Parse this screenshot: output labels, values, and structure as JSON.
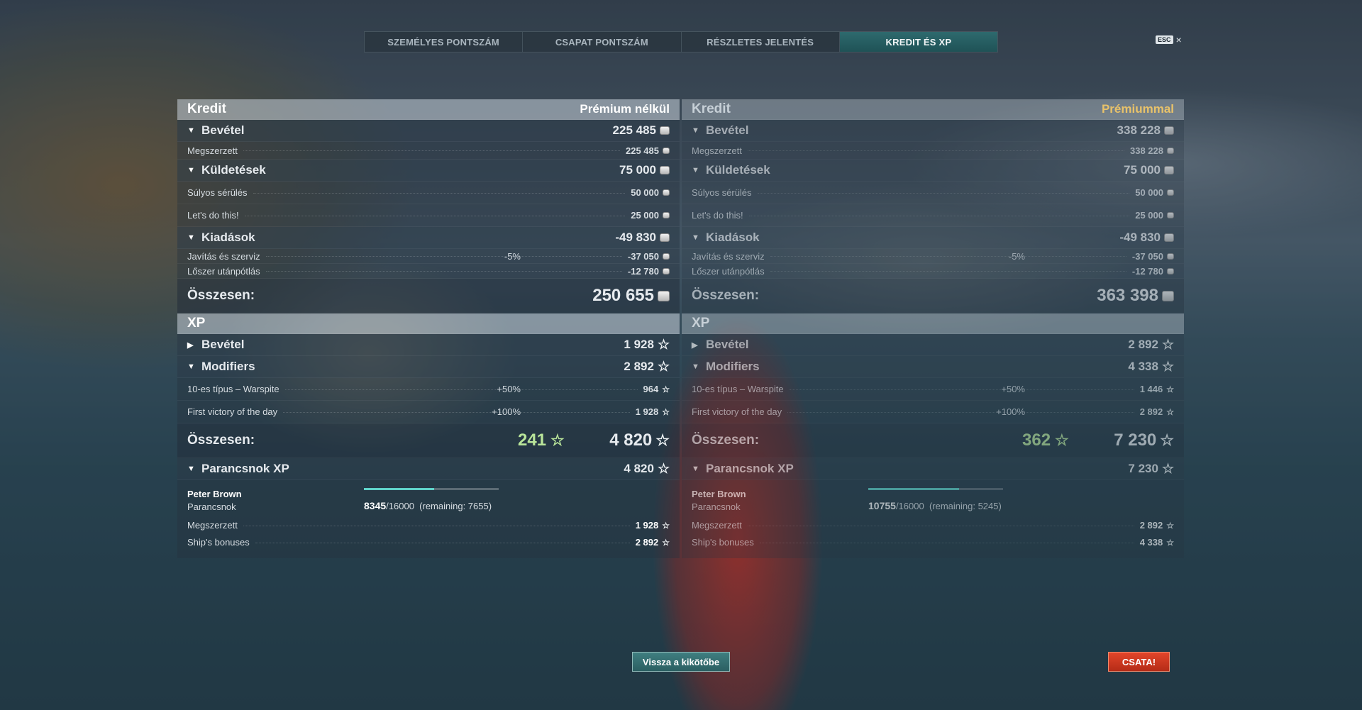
{
  "tabs": [
    "SZEMÉLYES PONTSZÁM",
    "CSAPAT PONTSZÁM",
    "RÉSZLETES JELENTÉS",
    "KREDIT ÉS XP"
  ],
  "active_tab": "KREDIT ÉS XP",
  "esc": {
    "key": "ESC",
    "close": "×"
  },
  "left": {
    "credit_title": "Kredit",
    "column_title": "Prémium nélkül",
    "income": {
      "label": "Bevétel",
      "value": "225 485"
    },
    "earned": {
      "label": "Megszerzett",
      "value": "225 485"
    },
    "missions": {
      "label": "Küldetések",
      "value": "75 000"
    },
    "mission1": {
      "label": "Súlyos sérülés",
      "value": "50 000"
    },
    "mission2": {
      "label": "Let's do this!",
      "value": "25 000"
    },
    "expenses": {
      "label": "Kiadások",
      "value": "-49 830"
    },
    "repair": {
      "label": "Javítás és szerviz",
      "pct": "-5%",
      "value": "-37 050"
    },
    "ammo": {
      "label": "Lőszer utánpótlás",
      "value": "-12 780"
    },
    "credit_total": {
      "label": "Összesen:",
      "value": "250 655"
    },
    "xp_title": "XP",
    "xp_income": {
      "label": "Bevétel",
      "value": "1 928"
    },
    "modifiers": {
      "label": "Modifiers",
      "value": "2 892"
    },
    "mod1": {
      "label": "10-es típus – Warspite",
      "pct": "+50%",
      "value": "964"
    },
    "mod2": {
      "label": "First victory of the day",
      "pct": "+100%",
      "value": "1 928"
    },
    "xp_total": {
      "label": "Összesen:",
      "free": "241",
      "value": "4 820"
    },
    "commander": {
      "label": "Parancsnok XP",
      "value": "4 820"
    },
    "cmd_name": "Peter Brown",
    "cmd_role": "Parancsnok",
    "cmd_current": "8345",
    "cmd_max": "/16000",
    "cmd_remaining": "(remaining: 7655)",
    "cmd_progress": 0.5216,
    "cmd_earned": {
      "label": "Megszerzett",
      "value": "1 928"
    },
    "cmd_bonus": {
      "label": "Ship's bonuses",
      "value": "2 892"
    }
  },
  "right": {
    "credit_title": "Kredit",
    "column_title": "Prémiummal",
    "income": {
      "label": "Bevétel",
      "value": "338 228"
    },
    "earned": {
      "label": "Megszerzett",
      "value": "338 228"
    },
    "missions": {
      "label": "Küldetések",
      "value": "75 000"
    },
    "mission1": {
      "label": "Súlyos sérülés",
      "value": "50 000"
    },
    "mission2": {
      "label": "Let's do this!",
      "value": "25 000"
    },
    "expenses": {
      "label": "Kiadások",
      "value": "-49 830"
    },
    "repair": {
      "label": "Javítás és szerviz",
      "pct": "-5%",
      "value": "-37 050"
    },
    "ammo": {
      "label": "Lőszer utánpótlás",
      "value": "-12 780"
    },
    "credit_total": {
      "label": "Összesen:",
      "value": "363 398"
    },
    "xp_title": "XP",
    "xp_income": {
      "label": "Bevétel",
      "value": "2 892"
    },
    "modifiers": {
      "label": "Modifiers",
      "value": "4 338"
    },
    "mod1": {
      "label": "10-es típus – Warspite",
      "pct": "+50%",
      "value": "1 446"
    },
    "mod2": {
      "label": "First victory of the day",
      "pct": "+100%",
      "value": "2 892"
    },
    "xp_total": {
      "label": "Összesen:",
      "free": "362",
      "value": "7 230"
    },
    "commander": {
      "label": "Parancsnok XP",
      "value": "7 230"
    },
    "cmd_name": "Peter Brown",
    "cmd_role": "Parancsnok",
    "cmd_current": "10755",
    "cmd_max": "/16000",
    "cmd_remaining": "(remaining: 5245)",
    "cmd_progress": 0.6722,
    "cmd_earned": {
      "label": "Megszerzett",
      "value": "2 892"
    },
    "cmd_bonus": {
      "label": "Ship's bonuses",
      "value": "4 338"
    }
  },
  "buttons": {
    "back": "Vissza a kikötőbe",
    "battle": "CSATA!"
  },
  "colors": {
    "accent_tab": "#2e6a6e",
    "premium": "#e8c26a",
    "free_xp": "#b9e59a",
    "battle": "#d23a22"
  }
}
